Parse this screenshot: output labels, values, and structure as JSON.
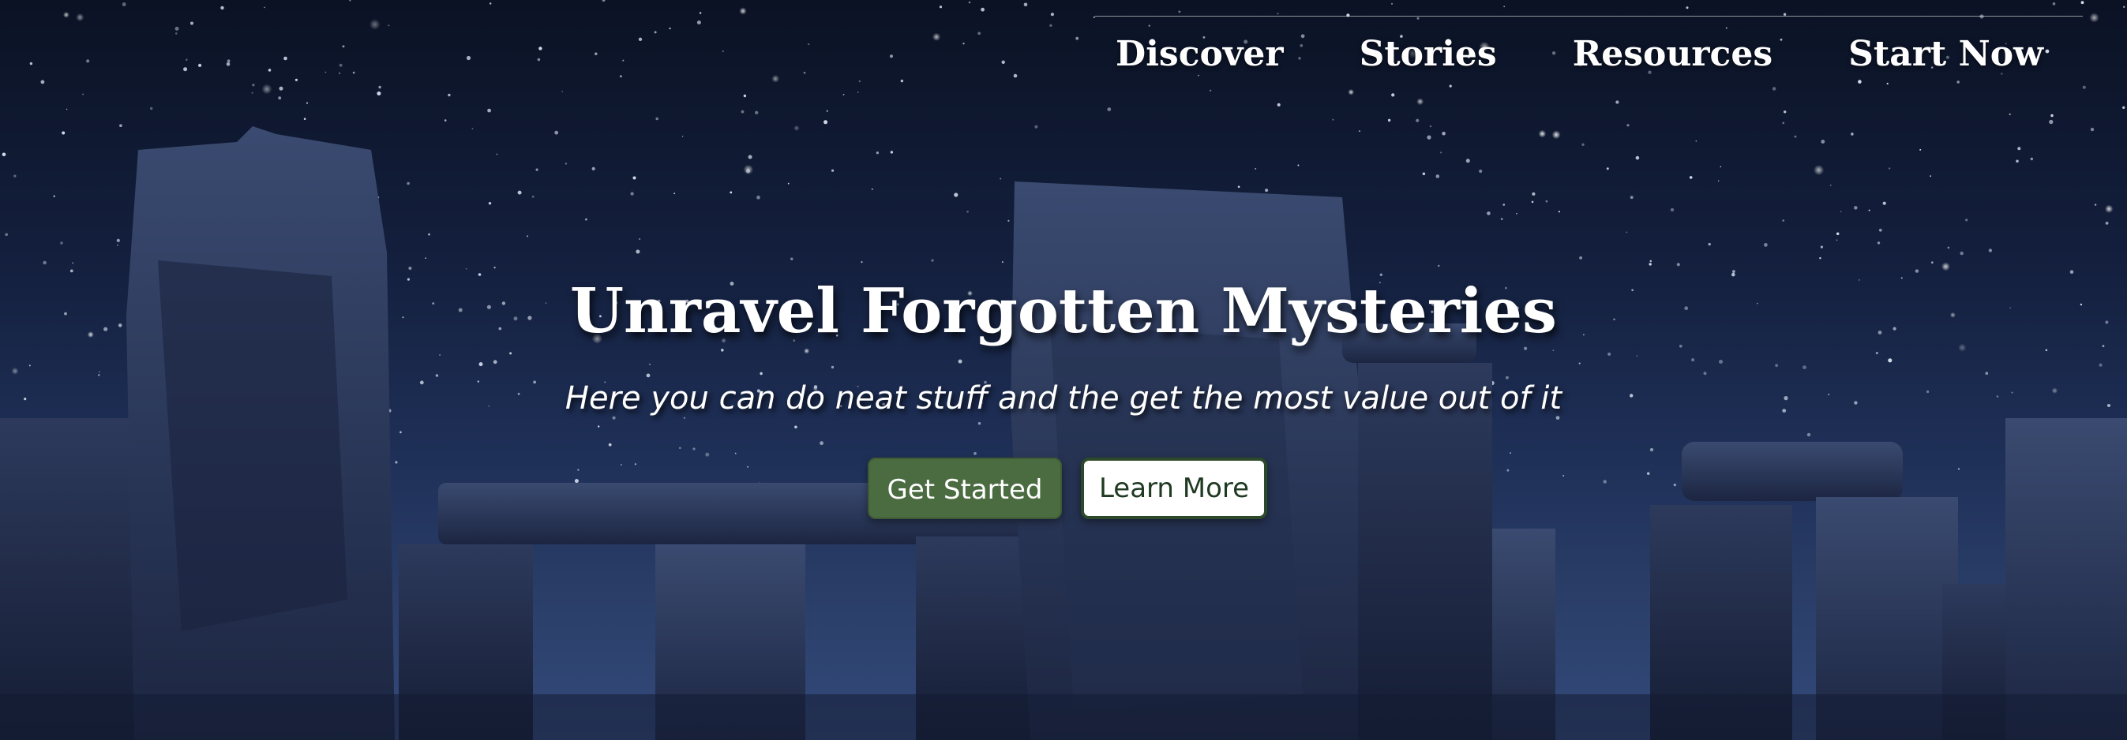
{
  "nav": {
    "items": [
      {
        "label": "Discover"
      },
      {
        "label": "Stories"
      },
      {
        "label": "Resources"
      },
      {
        "label": "Start Now"
      }
    ]
  },
  "hero": {
    "title": "Unravel Forgotten Mysteries",
    "subtitle": "Here you can do neat stuff and the get the most value out of it",
    "primary_button": "Get Started",
    "secondary_button": "Learn More",
    "background": "starry-night-stonehenge-image"
  },
  "colors": {
    "primary_button_bg": "#4b6b40",
    "secondary_button_border": "#2c4a2a",
    "sky_top": "#0b1224",
    "sky_bottom": "#33497a",
    "text": "#ffffff"
  }
}
